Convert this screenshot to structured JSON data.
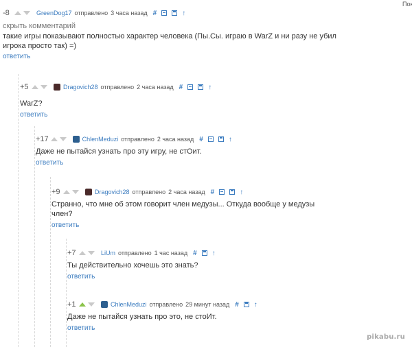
{
  "corner_text": "Пок",
  "watermark": "pikabu.ru",
  "labels": {
    "posted": "отправлено",
    "reply": "ответить",
    "hide": "скрыть комментарий",
    "hash": "#",
    "up": "↑"
  },
  "comments": [
    {
      "rating": "-8",
      "user": "GreenDog17",
      "time": "3 часа назад",
      "avatar_color": "",
      "text_lines": [
        "такие игры показывают полностью характер человека (Пы.Сы. играю в WarZ и ни разу не убил",
        "игрока просто так) =)"
      ],
      "upvoted": false
    },
    {
      "rating": "+5",
      "user": "Dragovich28",
      "time": "2 часа назад",
      "avatar_color": "#4a2a2a",
      "text_lines": [
        "WarZ?"
      ],
      "upvoted": false
    },
    {
      "rating": "+17",
      "user": "ChlenMeduzi",
      "time": "2 часа назад",
      "avatar_color": "#2d5f8f",
      "text_lines": [
        "Даже не пытайся узнать про эту игру, не стОит."
      ],
      "upvoted": false
    },
    {
      "rating": "+9",
      "user": "Dragovich28",
      "time": "2 часа назад",
      "avatar_color": "#4a2a2a",
      "text_lines": [
        "Странно, что мне об этом говорит член медузы... Откуда вообще у медузы",
        "член?"
      ],
      "upvoted": false
    },
    {
      "rating": "+7",
      "user": "LiUm",
      "time": "1 час назад",
      "avatar_color": "",
      "text_lines": [
        "Ты действительно хочешь это знать?"
      ],
      "upvoted": false
    },
    {
      "rating": "+1",
      "user": "ChlenMeduzi",
      "time": "29 минут назад",
      "avatar_color": "#2d5f8f",
      "text_lines": [
        "Даже не пытайся узнать про это, не стоИт."
      ],
      "upvoted": true
    }
  ]
}
